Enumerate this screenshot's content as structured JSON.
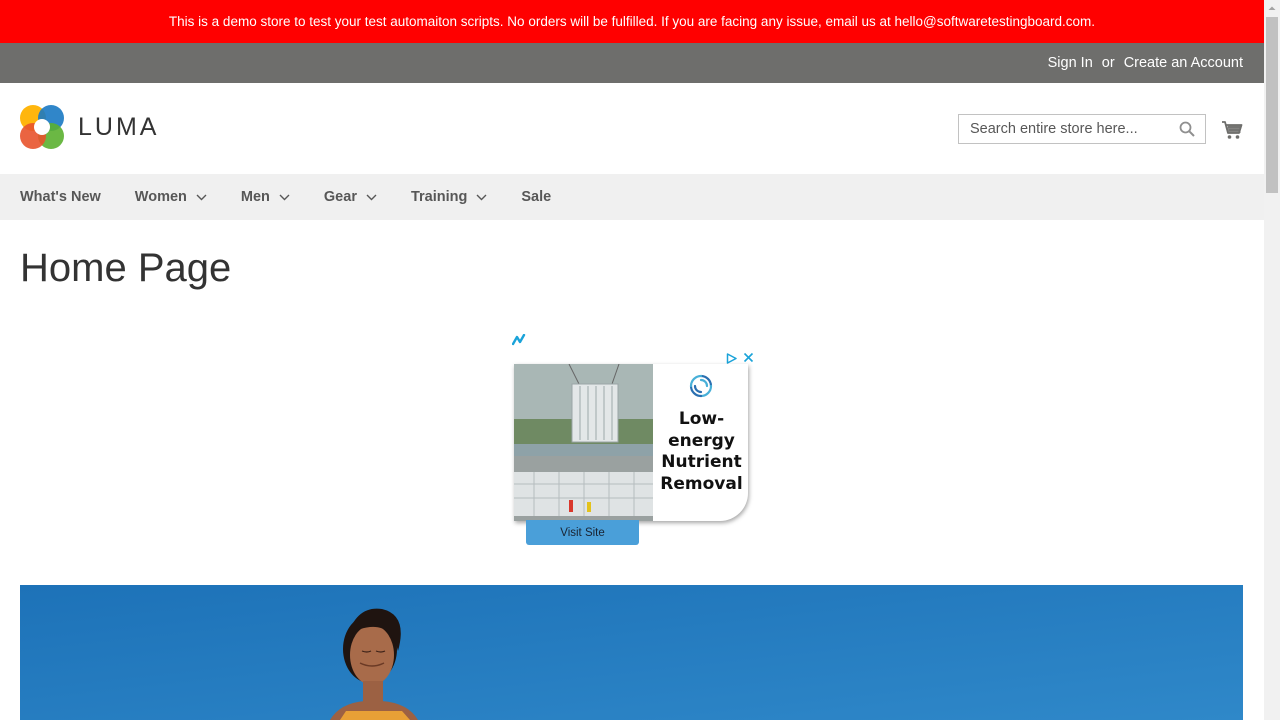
{
  "demo_banner": {
    "text": "This is a demo store to test your test automaiton scripts. No orders will be fulfilled. If you are facing any issue, email us at hello@softwaretestingboard.com.",
    "bg_color": "#ff0000"
  },
  "top_links": {
    "sign_in": "Sign In",
    "separator": "or",
    "create_account": "Create an Account"
  },
  "header": {
    "logo_text": "LUMA",
    "search": {
      "placeholder": "Search entire store here..."
    },
    "cart_icon": "cart-icon",
    "search_icon": "search-icon"
  },
  "nav": {
    "items": [
      {
        "label": "What's New",
        "has_dropdown": false
      },
      {
        "label": "Women",
        "has_dropdown": true
      },
      {
        "label": "Men",
        "has_dropdown": true
      },
      {
        "label": "Gear",
        "has_dropdown": true
      },
      {
        "label": "Training",
        "has_dropdown": true
      },
      {
        "label": "Sale",
        "has_dropdown": false
      }
    ]
  },
  "main": {
    "page_title": "Home Page"
  },
  "ad": {
    "headline_lines": [
      "Low-",
      "energy",
      "Nutrient",
      "Removal"
    ],
    "cta": "Visit Site",
    "cta_color": "#4a9fd9"
  },
  "colors": {
    "topbar": "#6e6e6c",
    "nav_bg": "#f0f0f0",
    "accent_blue": "#1979c3"
  }
}
